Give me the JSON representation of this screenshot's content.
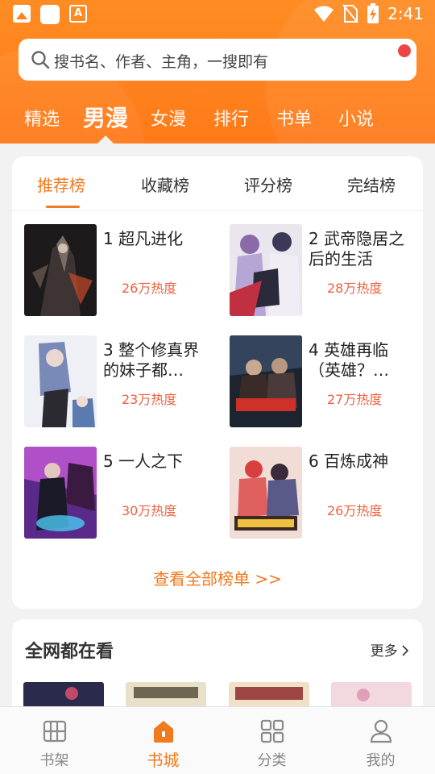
{
  "status": {
    "time": "2:41"
  },
  "search": {
    "placeholder": "搜书名、作者、主角，一搜即有"
  },
  "top_tabs": [
    "精选",
    "男漫",
    "女漫",
    "排行",
    "书单",
    "小说"
  ],
  "top_tabs_active": "男漫",
  "rank_tabs": [
    "推荐榜",
    "收藏榜",
    "评分榜",
    "完结榜"
  ],
  "rank_tabs_active": "推荐榜",
  "rankings": [
    {
      "rank": "1",
      "title": "超凡进化",
      "heat": "26万热度"
    },
    {
      "rank": "2",
      "title": "武帝隐居之后的生活",
      "heat": "28万热度"
    },
    {
      "rank": "3",
      "title": "整个修真界的妹子都…",
      "heat": "23万热度"
    },
    {
      "rank": "4",
      "title": "英雄再临（英雄？…",
      "heat": "27万热度"
    },
    {
      "rank": "5",
      "title": "一人之下",
      "heat": "30万热度"
    },
    {
      "rank": "6",
      "title": "百炼成神",
      "heat": "26万热度"
    }
  ],
  "view_all": "查看全部榜单 >>",
  "section2": {
    "title": "全网都在看",
    "more": "更多"
  },
  "bottom_nav": [
    {
      "label": "书架",
      "icon": "bookshelf-icon"
    },
    {
      "label": "书城",
      "icon": "home-icon"
    },
    {
      "label": "分类",
      "icon": "category-icon"
    },
    {
      "label": "我的",
      "icon": "user-icon"
    }
  ],
  "bottom_nav_active": "书城",
  "colors": {
    "accent": "#f07a1e",
    "header": "#ff8424",
    "heat": "#ee6040"
  }
}
